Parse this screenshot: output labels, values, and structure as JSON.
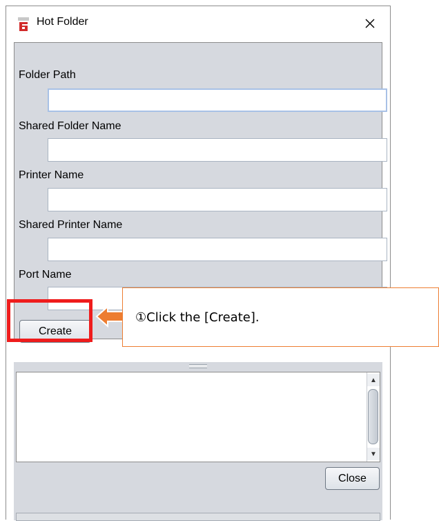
{
  "window": {
    "title": "Hot Folder",
    "app_icon": "printer-app-icon",
    "close_icon": "close-icon"
  },
  "form": {
    "fields": [
      {
        "label": "Folder Path",
        "value": ""
      },
      {
        "label": "Shared Folder Name",
        "value": ""
      },
      {
        "label": "Printer Name",
        "value": ""
      },
      {
        "label": "Shared Printer Name",
        "value": ""
      },
      {
        "label": "Port Name",
        "value": ""
      }
    ],
    "create_label": "Create"
  },
  "log": {
    "text": ""
  },
  "footer": {
    "close_label": "Close"
  },
  "annotation": {
    "callout_text": "①Click the [Create].",
    "highlight_color": "#ef1c1c",
    "arrow_color": "#ed7d31"
  }
}
